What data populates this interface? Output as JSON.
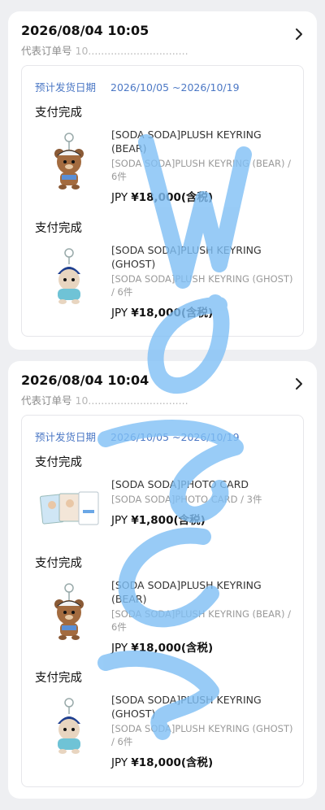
{
  "orders": [
    {
      "date": "2026/08/04 10:05",
      "number_label": "代表订单号",
      "number_value": "10...............................",
      "shipping_label": "预计发货日期",
      "shipping_range": "2026/10/05 ~2026/10/19",
      "items": [
        {
          "status": "支付完成",
          "name": "[SODA SODA]PLUSH KEYRING (BEAR)",
          "variant": "[SODA SODA]PLUSH KEYRING (BEAR) / 6件",
          "currency": "JPY",
          "price": "¥18,000(含税)",
          "image": "bear-keyring"
        },
        {
          "status": "支付完成",
          "name": "[SODA SODA]PLUSH KEYRING (GHOST)",
          "variant": "[SODA SODA]PLUSH KEYRING (GHOST) / 6件",
          "currency": "JPY",
          "price": "¥18,000(含税)",
          "image": "ghost-keyring"
        }
      ]
    },
    {
      "date": "2026/08/04 10:04",
      "number_label": "代表订单号",
      "number_value": "10...............................",
      "shipping_label": "预计发货日期",
      "shipping_range": "2026/10/05 ~2026/10/19",
      "items": [
        {
          "status": "支付完成",
          "name": "[SODA SODA]PHOTO CARD",
          "variant": "[SODA SODA]PHOTO CARD / 3件",
          "currency": "JPY",
          "price": "¥1,800(含税)",
          "image": "photo-card"
        },
        {
          "status": "支付完成",
          "name": "[SODA SODA]PLUSH KEYRING (BEAR)",
          "variant": "[SODA SODA]PLUSH KEYRING (BEAR) / 6件",
          "currency": "JPY",
          "price": "¥18,000(含税)",
          "image": "bear-keyring"
        },
        {
          "status": "支付完成",
          "name": "[SODA SODA]PLUSH KEYRING (GHOST)",
          "variant": "[SODA SODA]PLUSH KEYRING (GHOST) / 6件",
          "currency": "JPY",
          "price": "¥18,000(含税)",
          "image": "ghost-keyring"
        }
      ]
    }
  ],
  "colors": {
    "accent": "#4c78c5",
    "watermark": "#7fbff5",
    "background": "#eeeff2"
  }
}
